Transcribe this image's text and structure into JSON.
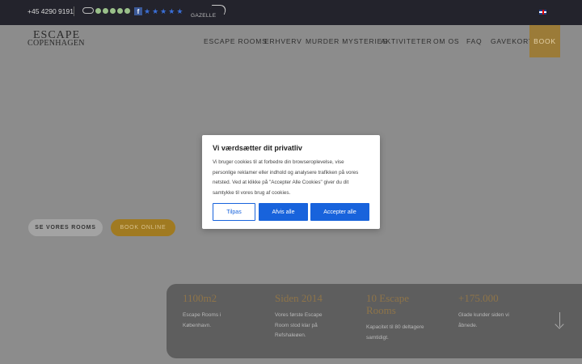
{
  "topbar": {
    "phone": "+45 4290 9191",
    "gazelle_text": "GAZELLE",
    "flag_icon": "uk-flag-icon"
  },
  "navbar": {
    "logo_top": "ESCAPE",
    "logo_bottom": "COPENHAGEN",
    "items": [
      "ESCAPE ROOMS",
      "ERHVERV",
      "MURDER MYSTERIES",
      "AKTIVITETER",
      "OM OS",
      "FAQ",
      "GAVEKORT"
    ],
    "book": "BOOK"
  },
  "hero": {
    "see_rooms": "SE VORES ROOMS",
    "book_online": "BOOK ONLINE"
  },
  "stats": [
    {
      "heading": "1100m2",
      "text": [
        "Escape Rooms i",
        "København."
      ]
    },
    {
      "heading": "Siden 2014",
      "text": [
        "Vores første Escape",
        "Room stod klar på",
        "Refshaleøen."
      ]
    },
    {
      "heading": "10 Escape Rooms",
      "heading_lines": [
        "10 Escape",
        "Rooms"
      ],
      "text": [
        "Kapacitet til 80 deltagere",
        "samtidigt."
      ]
    },
    {
      "heading": "+175.000",
      "text": [
        "Glade kunder siden vi",
        "åbnede."
      ]
    }
  ],
  "cookie": {
    "title": "Vi værdsætter dit privatliv",
    "body_lines": [
      "Vi bruger cookies til at forbedre din browseroplevelse, vise",
      "personlige reklamer eller indhold og analysere trafikken på vores",
      "netsted. Ved at klikke på \"Accepter Alle Cookies\" giver du dit",
      "samtykke til vores brug af cookies."
    ],
    "customize": "Tilpas",
    "reject": "Afvis alle",
    "accept": "Accepter alle"
  },
  "colors": {
    "topbar": "#23232c",
    "accent_gold": "#9b7b38",
    "cookie_blue": "#1863dc"
  }
}
